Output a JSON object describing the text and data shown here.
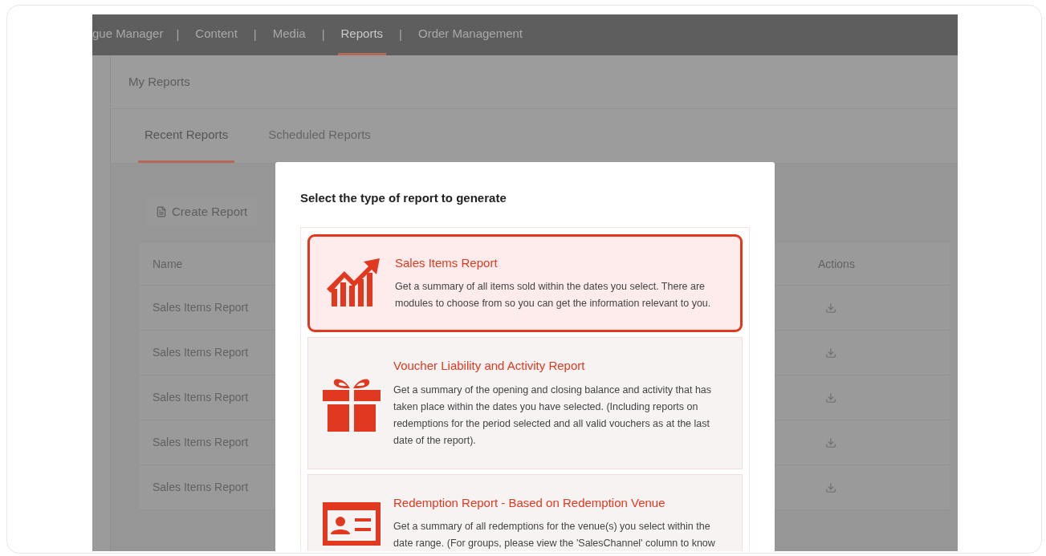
{
  "nav": {
    "items": [
      {
        "label": "gue Manager",
        "selected": false
      },
      {
        "label": "Content",
        "selected": false
      },
      {
        "label": "Media",
        "selected": false
      },
      {
        "label": "Reports",
        "selected": true
      },
      {
        "label": "Order Management",
        "selected": false
      }
    ],
    "separator": "|"
  },
  "page_title": "My Reports",
  "tabs": [
    {
      "label": "Recent Reports",
      "selected": true
    },
    {
      "label": "Scheduled Reports",
      "selected": false
    }
  ],
  "create_button": "Create Report",
  "table": {
    "columns": [
      "Name",
      "Actions"
    ],
    "rows": [
      {
        "name": "Sales Items Report"
      },
      {
        "name": "Sales Items Report"
      },
      {
        "name": "Sales Items Report"
      },
      {
        "name": "Sales Items Report"
      },
      {
        "name": "Sales Items Report"
      }
    ]
  },
  "modal": {
    "title": "Select the type of report to generate",
    "options": [
      {
        "kind": "chart",
        "selected": true,
        "title": "Sales Items Report",
        "description": "Get a summary of all items sold within the dates you select. There are modules to choose from so you can get the information relevant to you."
      },
      {
        "kind": "gift",
        "selected": false,
        "title": "Voucher Liability and Activity Report",
        "description": "Get a summary of the opening and closing balance and activity that has taken place within the dates you have selected. (Including reports on redemptions for the period selected and all valid vouchers as at the last date of the report)."
      },
      {
        "kind": "card",
        "selected": false,
        "title": "Redemption Report - Based on Redemption Venue",
        "description": "Get a summary of all redemptions for the venue(s) you select within the date range. (For groups, please view the 'SalesChannel' column to know"
      }
    ]
  }
}
